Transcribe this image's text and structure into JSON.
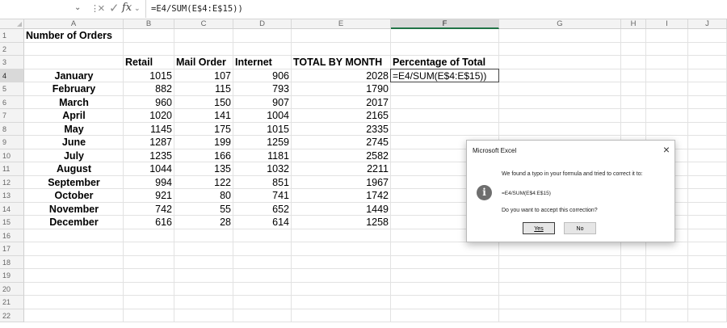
{
  "formula_bar": {
    "chevron": "⌄",
    "separator": "⋮",
    "cancel_icon": "×",
    "enter_icon": "✓",
    "fx_label": "fx",
    "fx_chevron": "⌄",
    "formula_text": "=E4/SUM(E$4:E$15))"
  },
  "columns": [
    "A",
    "B",
    "C",
    "D",
    "E",
    "F",
    "G",
    "H",
    "I",
    "J"
  ],
  "rows": [
    "1",
    "2",
    "3",
    "4",
    "5",
    "6",
    "7",
    "8",
    "9",
    "10",
    "11",
    "12",
    "13",
    "14",
    "15",
    "16",
    "17",
    "18",
    "19",
    "20",
    "21",
    "22"
  ],
  "sheet": {
    "title": "Number of Orders",
    "headers": {
      "retail": "Retail",
      "mail_order": "Mail Order",
      "internet": "Internet",
      "total": "TOTAL BY MONTH",
      "percentage": "Percentage of Total"
    },
    "data": [
      {
        "month": "January",
        "retail": "1015",
        "mail": "107",
        "internet": "906",
        "total": "2028"
      },
      {
        "month": "February",
        "retail": "882",
        "mail": "115",
        "internet": "793",
        "total": "1790"
      },
      {
        "month": "March",
        "retail": "960",
        "mail": "150",
        "internet": "907",
        "total": "2017"
      },
      {
        "month": "April",
        "retail": "1020",
        "mail": "141",
        "internet": "1004",
        "total": "2165"
      },
      {
        "month": "May",
        "retail": "1145",
        "mail": "175",
        "internet": "1015",
        "total": "2335"
      },
      {
        "month": "June",
        "retail": "1287",
        "mail": "199",
        "internet": "1259",
        "total": "2745"
      },
      {
        "month": "July",
        "retail": "1235",
        "mail": "166",
        "internet": "1181",
        "total": "2582"
      },
      {
        "month": "August",
        "retail": "1044",
        "mail": "135",
        "internet": "1032",
        "total": "2211"
      },
      {
        "month": "September",
        "retail": "994",
        "mail": "122",
        "internet": "851",
        "total": "1967"
      },
      {
        "month": "October",
        "retail": "921",
        "mail": "80",
        "internet": "741",
        "total": "1742"
      },
      {
        "month": "November",
        "retail": "742",
        "mail": "55",
        "internet": "652",
        "total": "1449"
      },
      {
        "month": "December",
        "retail": "616",
        "mail": "28",
        "internet": "614",
        "total": "1258"
      }
    ],
    "active_cell_value": "=E4/SUM(E$4:E$15))"
  },
  "dialog": {
    "title": "Microsoft Excel",
    "close": "×",
    "message": "We found a typo in your formula and tried to correct it to:",
    "info_glyph": "i",
    "corrected_formula": "=E4/SUM(E$4:E$15)",
    "question": "Do you want to accept this correction?",
    "yes_label": "Yes",
    "no_label": "No"
  }
}
